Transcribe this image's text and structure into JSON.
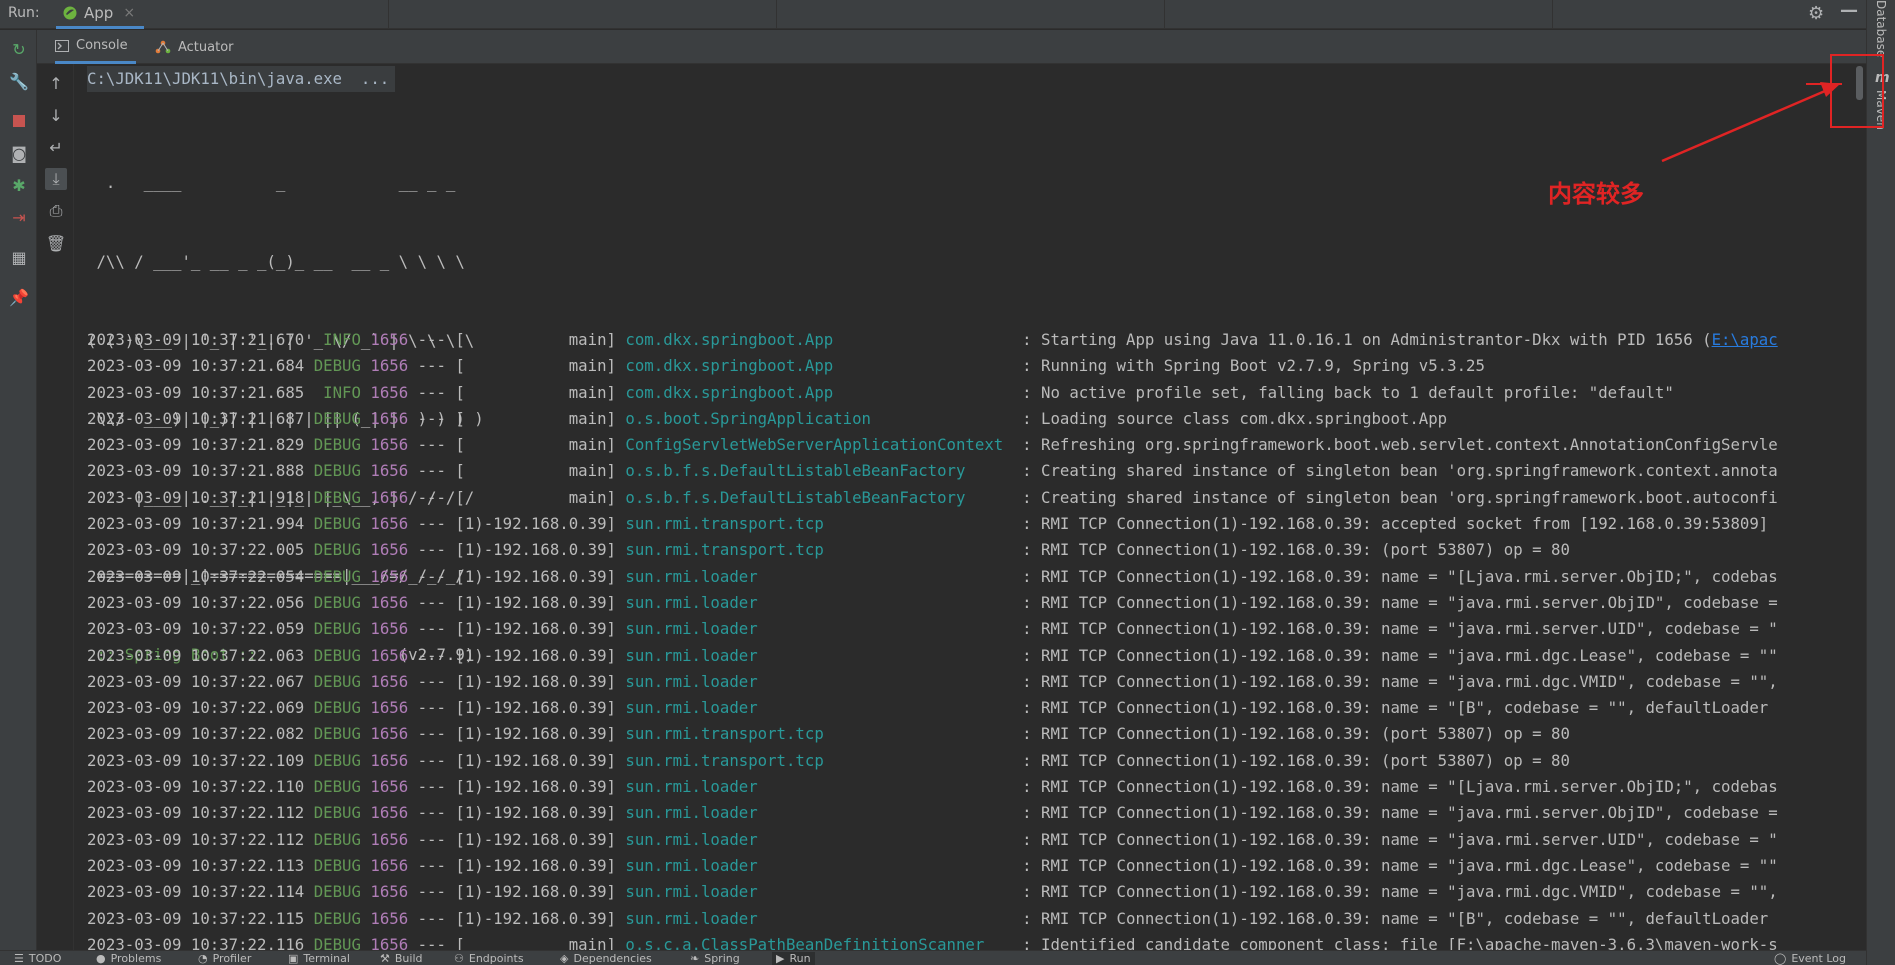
{
  "run_header": {
    "label": "Run:",
    "tab_title": "App",
    "tab_close": "×"
  },
  "tool_tabs": [
    {
      "label": "Console"
    },
    {
      "label": "Actuator"
    }
  ],
  "console": {
    "command": "C:\\JDK11\\JDK11\\bin\\java.exe  ...",
    "banner_lines": [
      "  .   ____          _            __ _ _",
      " /\\\\ / ___'_ __ _ _(_)_ __  __ _ \\ \\ \\ \\",
      "( ( )\\___ | '_ | '_| | '_ \\/ _` | \\ \\ \\ \\",
      " \\\\/  ___)| |_)| | | | | || (_| |  ) ) ) )",
      "  '  |____| .__|_| |_|_| |_\\__, | / / / /",
      " =========|_|==============|___/=/_/_/_/"
    ],
    "banner_footer": {
      "label": " :: Spring Boot ::",
      "version": "(v2.7.9)"
    },
    "log_lines": [
      {
        "ts": "2023-03-09 10:37:21.670",
        "lvl": " INFO",
        "pid": "1656",
        "sep": "---",
        "thread": "[           main]",
        "logger": "com.dkx.springboot.App                   ",
        "msg": ": Starting App using Java 11.0.16.1 on Administrantor-Dkx with PID 1656 (",
        "link": "E:\\apac"
      },
      {
        "ts": "2023-03-09 10:37:21.684",
        "lvl": "DEBUG",
        "pid": "1656",
        "sep": "---",
        "thread": "[           main]",
        "logger": "com.dkx.springboot.App                   ",
        "msg": ": Running with Spring Boot v2.7.9, Spring v5.3.25",
        "link": ""
      },
      {
        "ts": "2023-03-09 10:37:21.685",
        "lvl": " INFO",
        "pid": "1656",
        "sep": "---",
        "thread": "[           main]",
        "logger": "com.dkx.springboot.App                   ",
        "msg": ": No active profile set, falling back to 1 default profile: \"default\"",
        "link": ""
      },
      {
        "ts": "2023-03-09 10:37:21.687",
        "lvl": "DEBUG",
        "pid": "1656",
        "sep": "---",
        "thread": "[           main]",
        "logger": "o.s.boot.SpringApplication               ",
        "msg": ": Loading source class com.dkx.springboot.App",
        "link": ""
      },
      {
        "ts": "2023-03-09 10:37:21.829",
        "lvl": "DEBUG",
        "pid": "1656",
        "sep": "---",
        "thread": "[           main]",
        "logger": "ConfigServletWebServerApplicationContext ",
        "msg": ": Refreshing org.springframework.boot.web.servlet.context.AnnotationConfigServle",
        "link": ""
      },
      {
        "ts": "2023-03-09 10:37:21.888",
        "lvl": "DEBUG",
        "pid": "1656",
        "sep": "---",
        "thread": "[           main]",
        "logger": "o.s.b.f.s.DefaultListableBeanFactory     ",
        "msg": ": Creating shared instance of singleton bean 'org.springframework.context.annota",
        "link": ""
      },
      {
        "ts": "2023-03-09 10:37:21.918",
        "lvl": "DEBUG",
        "pid": "1656",
        "sep": "---",
        "thread": "[           main]",
        "logger": "o.s.b.f.s.DefaultListableBeanFactory     ",
        "msg": ": Creating shared instance of singleton bean 'org.springframework.boot.autoconfi",
        "link": ""
      },
      {
        "ts": "2023-03-09 10:37:21.994",
        "lvl": "DEBUG",
        "pid": "1656",
        "sep": "---",
        "thread": "[1)-192.168.0.39]",
        "logger": "sun.rmi.transport.tcp                    ",
        "msg": ": RMI TCP Connection(1)-192.168.0.39: accepted socket from [192.168.0.39:53809]",
        "link": ""
      },
      {
        "ts": "2023-03-09 10:37:22.005",
        "lvl": "DEBUG",
        "pid": "1656",
        "sep": "---",
        "thread": "[1)-192.168.0.39]",
        "logger": "sun.rmi.transport.tcp                    ",
        "msg": ": RMI TCP Connection(1)-192.168.0.39: (port 53807) op = 80",
        "link": ""
      },
      {
        "ts": "2023-03-09 10:37:22.054",
        "lvl": "DEBUG",
        "pid": "1656",
        "sep": "---",
        "thread": "[1)-192.168.0.39]",
        "logger": "sun.rmi.loader                           ",
        "msg": ": RMI TCP Connection(1)-192.168.0.39: name = \"[Ljava.rmi.server.ObjID;\", codebas",
        "link": ""
      },
      {
        "ts": "2023-03-09 10:37:22.056",
        "lvl": "DEBUG",
        "pid": "1656",
        "sep": "---",
        "thread": "[1)-192.168.0.39]",
        "logger": "sun.rmi.loader                           ",
        "msg": ": RMI TCP Connection(1)-192.168.0.39: name = \"java.rmi.server.ObjID\", codebase =",
        "link": ""
      },
      {
        "ts": "2023-03-09 10:37:22.059",
        "lvl": "DEBUG",
        "pid": "1656",
        "sep": "---",
        "thread": "[1)-192.168.0.39]",
        "logger": "sun.rmi.loader                           ",
        "msg": ": RMI TCP Connection(1)-192.168.0.39: name = \"java.rmi.server.UID\", codebase = \"",
        "link": ""
      },
      {
        "ts": "2023-03-09 10:37:22.063",
        "lvl": "DEBUG",
        "pid": "1656",
        "sep": "---",
        "thread": "[1)-192.168.0.39]",
        "logger": "sun.rmi.loader                           ",
        "msg": ": RMI TCP Connection(1)-192.168.0.39: name = \"java.rmi.dgc.Lease\", codebase = \"\"",
        "link": ""
      },
      {
        "ts": "2023-03-09 10:37:22.067",
        "lvl": "DEBUG",
        "pid": "1656",
        "sep": "---",
        "thread": "[1)-192.168.0.39]",
        "logger": "sun.rmi.loader                           ",
        "msg": ": RMI TCP Connection(1)-192.168.0.39: name = \"java.rmi.dgc.VMID\", codebase = \"\",",
        "link": ""
      },
      {
        "ts": "2023-03-09 10:37:22.069",
        "lvl": "DEBUG",
        "pid": "1656",
        "sep": "---",
        "thread": "[1)-192.168.0.39]",
        "logger": "sun.rmi.loader                           ",
        "msg": ": RMI TCP Connection(1)-192.168.0.39: name = \"[B\", codebase = \"\", defaultLoader",
        "link": ""
      },
      {
        "ts": "2023-03-09 10:37:22.082",
        "lvl": "DEBUG",
        "pid": "1656",
        "sep": "---",
        "thread": "[1)-192.168.0.39]",
        "logger": "sun.rmi.transport.tcp                    ",
        "msg": ": RMI TCP Connection(1)-192.168.0.39: (port 53807) op = 80",
        "link": ""
      },
      {
        "ts": "2023-03-09 10:37:22.109",
        "lvl": "DEBUG",
        "pid": "1656",
        "sep": "---",
        "thread": "[1)-192.168.0.39]",
        "logger": "sun.rmi.transport.tcp                    ",
        "msg": ": RMI TCP Connection(1)-192.168.0.39: (port 53807) op = 80",
        "link": ""
      },
      {
        "ts": "2023-03-09 10:37:22.110",
        "lvl": "DEBUG",
        "pid": "1656",
        "sep": "---",
        "thread": "[1)-192.168.0.39]",
        "logger": "sun.rmi.loader                           ",
        "msg": ": RMI TCP Connection(1)-192.168.0.39: name = \"[Ljava.rmi.server.ObjID;\", codebas",
        "link": ""
      },
      {
        "ts": "2023-03-09 10:37:22.112",
        "lvl": "DEBUG",
        "pid": "1656",
        "sep": "---",
        "thread": "[1)-192.168.0.39]",
        "logger": "sun.rmi.loader                           ",
        "msg": ": RMI TCP Connection(1)-192.168.0.39: name = \"java.rmi.server.ObjID\", codebase =",
        "link": ""
      },
      {
        "ts": "2023-03-09 10:37:22.112",
        "lvl": "DEBUG",
        "pid": "1656",
        "sep": "---",
        "thread": "[1)-192.168.0.39]",
        "logger": "sun.rmi.loader                           ",
        "msg": ": RMI TCP Connection(1)-192.168.0.39: name = \"java.rmi.server.UID\", codebase = \"",
        "link": ""
      },
      {
        "ts": "2023-03-09 10:37:22.113",
        "lvl": "DEBUG",
        "pid": "1656",
        "sep": "---",
        "thread": "[1)-192.168.0.39]",
        "logger": "sun.rmi.loader                           ",
        "msg": ": RMI TCP Connection(1)-192.168.0.39: name = \"java.rmi.dgc.Lease\", codebase = \"\"",
        "link": ""
      },
      {
        "ts": "2023-03-09 10:37:22.114",
        "lvl": "DEBUG",
        "pid": "1656",
        "sep": "---",
        "thread": "[1)-192.168.0.39]",
        "logger": "sun.rmi.loader                           ",
        "msg": ": RMI TCP Connection(1)-192.168.0.39: name = \"java.rmi.dgc.VMID\", codebase = \"\",",
        "link": ""
      },
      {
        "ts": "2023-03-09 10:37:22.115",
        "lvl": "DEBUG",
        "pid": "1656",
        "sep": "---",
        "thread": "[1)-192.168.0.39]",
        "logger": "sun.rmi.loader                           ",
        "msg": ": RMI TCP Connection(1)-192.168.0.39: name = \"[B\", codebase = \"\", defaultLoader",
        "link": ""
      },
      {
        "ts": "2023-03-09 10:37:22.116",
        "lvl": "DEBUG",
        "pid": "1656",
        "sep": "---",
        "thread": "[           main]",
        "logger": "o.s.c.a.ClassPathBeanDefinitionScanner   ",
        "msg": ": Identified candidate component class: file [F:\\apache-maven-3.6.3\\maven-work-s",
        "link": ""
      }
    ]
  },
  "right_stripe": {
    "database": "Database",
    "maven": "Maven",
    "maven_icon": "m"
  },
  "bottom_tabs": [
    "TODO",
    "Problems",
    "Profiler",
    "Terminal",
    "Build",
    "Endpoints",
    "Dependencies",
    "Spring",
    "Run",
    "Event Log"
  ],
  "annotation": {
    "text": "内容较多",
    "color": "#e02424"
  },
  "icons": {
    "rerun": "rerun-icon",
    "settings": "wrench-icon",
    "stop": "stop-icon",
    "screenshot": "camera-icon",
    "debug": "bug-icon",
    "exit": "exit-icon",
    "layout": "layout-icon",
    "pin": "pin-icon",
    "up": "arrow-up-icon",
    "down": "arrow-down-icon",
    "wrap": "soft-wrap-icon",
    "scroll": "scroll-to-end-icon",
    "print": "print-icon",
    "trash": "trash-icon",
    "gear": "gear-icon",
    "minimize": "minimize-icon"
  }
}
